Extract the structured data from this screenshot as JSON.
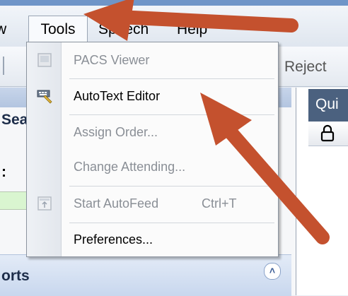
{
  "menubar": {
    "view_partial": "w",
    "tools": "Tools",
    "speech": "Speech",
    "help": "Help"
  },
  "toolbar": {
    "reject_label": "Reject",
    "reject_icon": "reject-icon"
  },
  "tools_menu": {
    "items": [
      {
        "label": "PACS Viewer",
        "enabled": false,
        "icon": "pacs-viewer-icon"
      },
      {
        "label": "AutoText Editor",
        "enabled": true,
        "icon": "autotext-editor-icon"
      },
      {
        "label": "Assign Order...",
        "enabled": false
      },
      {
        "label": "Change Attending...",
        "enabled": false
      },
      {
        "label": "Start AutoFeed",
        "enabled": false,
        "shortcut": "Ctrl+T",
        "icon": "autofeed-icon"
      },
      {
        "label": "Preferences...",
        "enabled": true
      }
    ]
  },
  "left_panel": {
    "search_fragment": "Sea",
    "colon_fragment": ":",
    "reports_fragment": "orts"
  },
  "right_panel": {
    "header_fragment": "Qui",
    "lock_icon": "lock-icon"
  },
  "annotation": {
    "arrow_color": "#c4512e"
  }
}
